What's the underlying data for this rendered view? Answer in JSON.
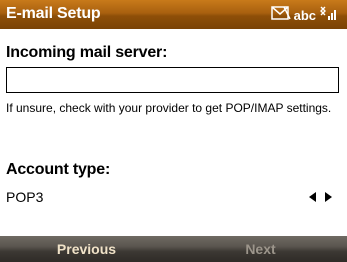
{
  "window": {
    "title": "E-mail Setup",
    "input_mode": "abc"
  },
  "icons": {
    "message": "envelope-icon",
    "signal": "signal-strength-icon"
  },
  "form": {
    "server_label": "Incoming mail server:",
    "server_value": "",
    "help_text": "If unsure, check with your provider to get POP/IMAP settings.",
    "account_type_label": "Account type:",
    "account_type_value": "POP3"
  },
  "softkeys": {
    "left": "Previous",
    "right": "Next",
    "right_enabled": false
  },
  "colors": {
    "title_bar": "#a8600f",
    "softkey_bar": "#4a4640",
    "softkey_text": "#f0e2c8",
    "softkey_disabled": "#9c958b"
  }
}
